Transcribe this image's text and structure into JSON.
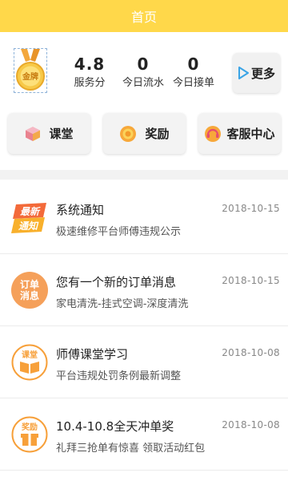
{
  "header": {
    "title": "首页"
  },
  "stats": {
    "medal_text": "金牌",
    "items": [
      {
        "value": "4.8",
        "label": "服务分"
      },
      {
        "value": "0",
        "label": "今日流水"
      },
      {
        "value": "0",
        "label": "今日接单"
      }
    ],
    "more_label": "更多"
  },
  "quick_actions": [
    {
      "label": "课堂",
      "icon": "cube-icon"
    },
    {
      "label": "奖励",
      "icon": "coin-icon"
    },
    {
      "label": "客服中心",
      "icon": "headset-icon"
    }
  ],
  "messages": [
    {
      "icon": "new-notice-icon",
      "icon_text_1": "最新",
      "icon_text_2": "通知",
      "title": "系统通知",
      "subtitle": "极速维修平台师傅违规公示",
      "date": "2018-10-15"
    },
    {
      "icon": "order-message-icon",
      "icon_text_1": "订单",
      "icon_text_2": "消息",
      "title": "您有一个新的订单消息",
      "subtitle": "家电清洗-挂式空调-深度清洗",
      "date": "2018-10-15"
    },
    {
      "icon": "classroom-icon",
      "icon_text_1": "课堂",
      "title": "师傅课堂学习",
      "subtitle": "平台违规处罚条例最新调整",
      "date": "2018-10-08"
    },
    {
      "icon": "reward-gift-icon",
      "icon_text_1": "奖励",
      "title": "10.4-10.8全天冲单奖",
      "subtitle": "礼拜三抢单有惊喜 领取活动红包",
      "date": "2018-10-08"
    }
  ],
  "colors": {
    "header": "#ffd84a",
    "orange": "#f7a03a",
    "pink": "#f36b6b"
  }
}
